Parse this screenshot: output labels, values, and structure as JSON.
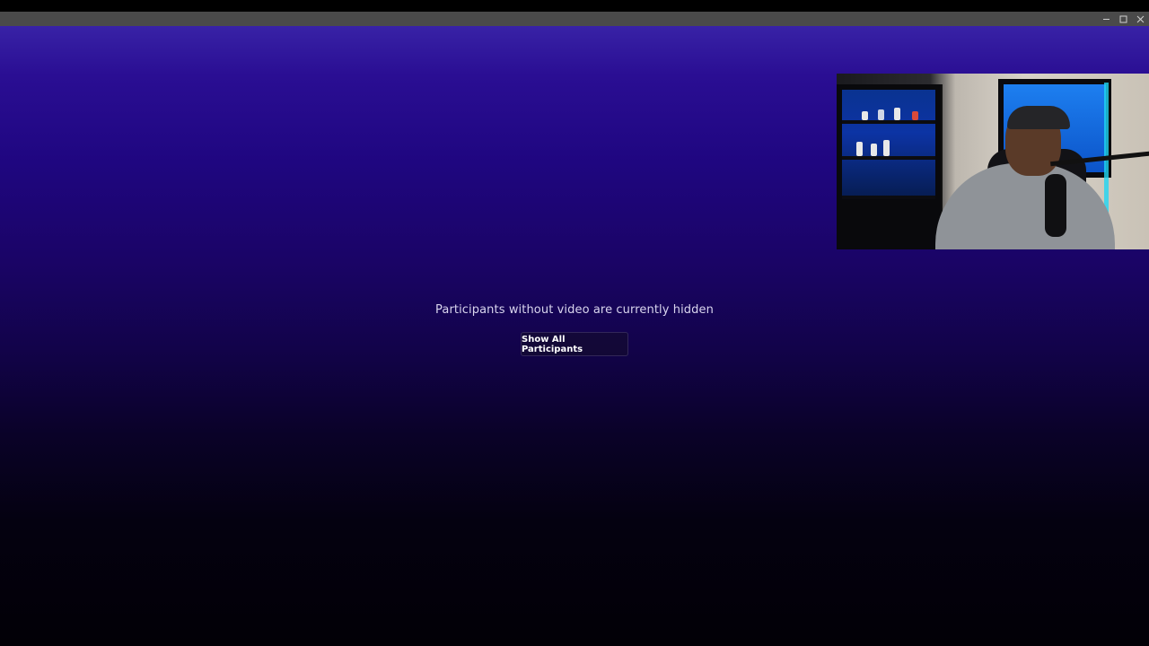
{
  "window": {
    "controls": [
      "minimize-icon",
      "maximize-icon",
      "close-icon"
    ]
  },
  "stage": {
    "message": "Participants without video are currently hidden",
    "show_all_label": "Show All Participants"
  },
  "video_tile": {
    "content": "participant-webcam-video"
  },
  "colors": {
    "gradient_top": "#3822a6",
    "gradient_bottom": "#020006",
    "titlebar": "#4a4a4a"
  }
}
